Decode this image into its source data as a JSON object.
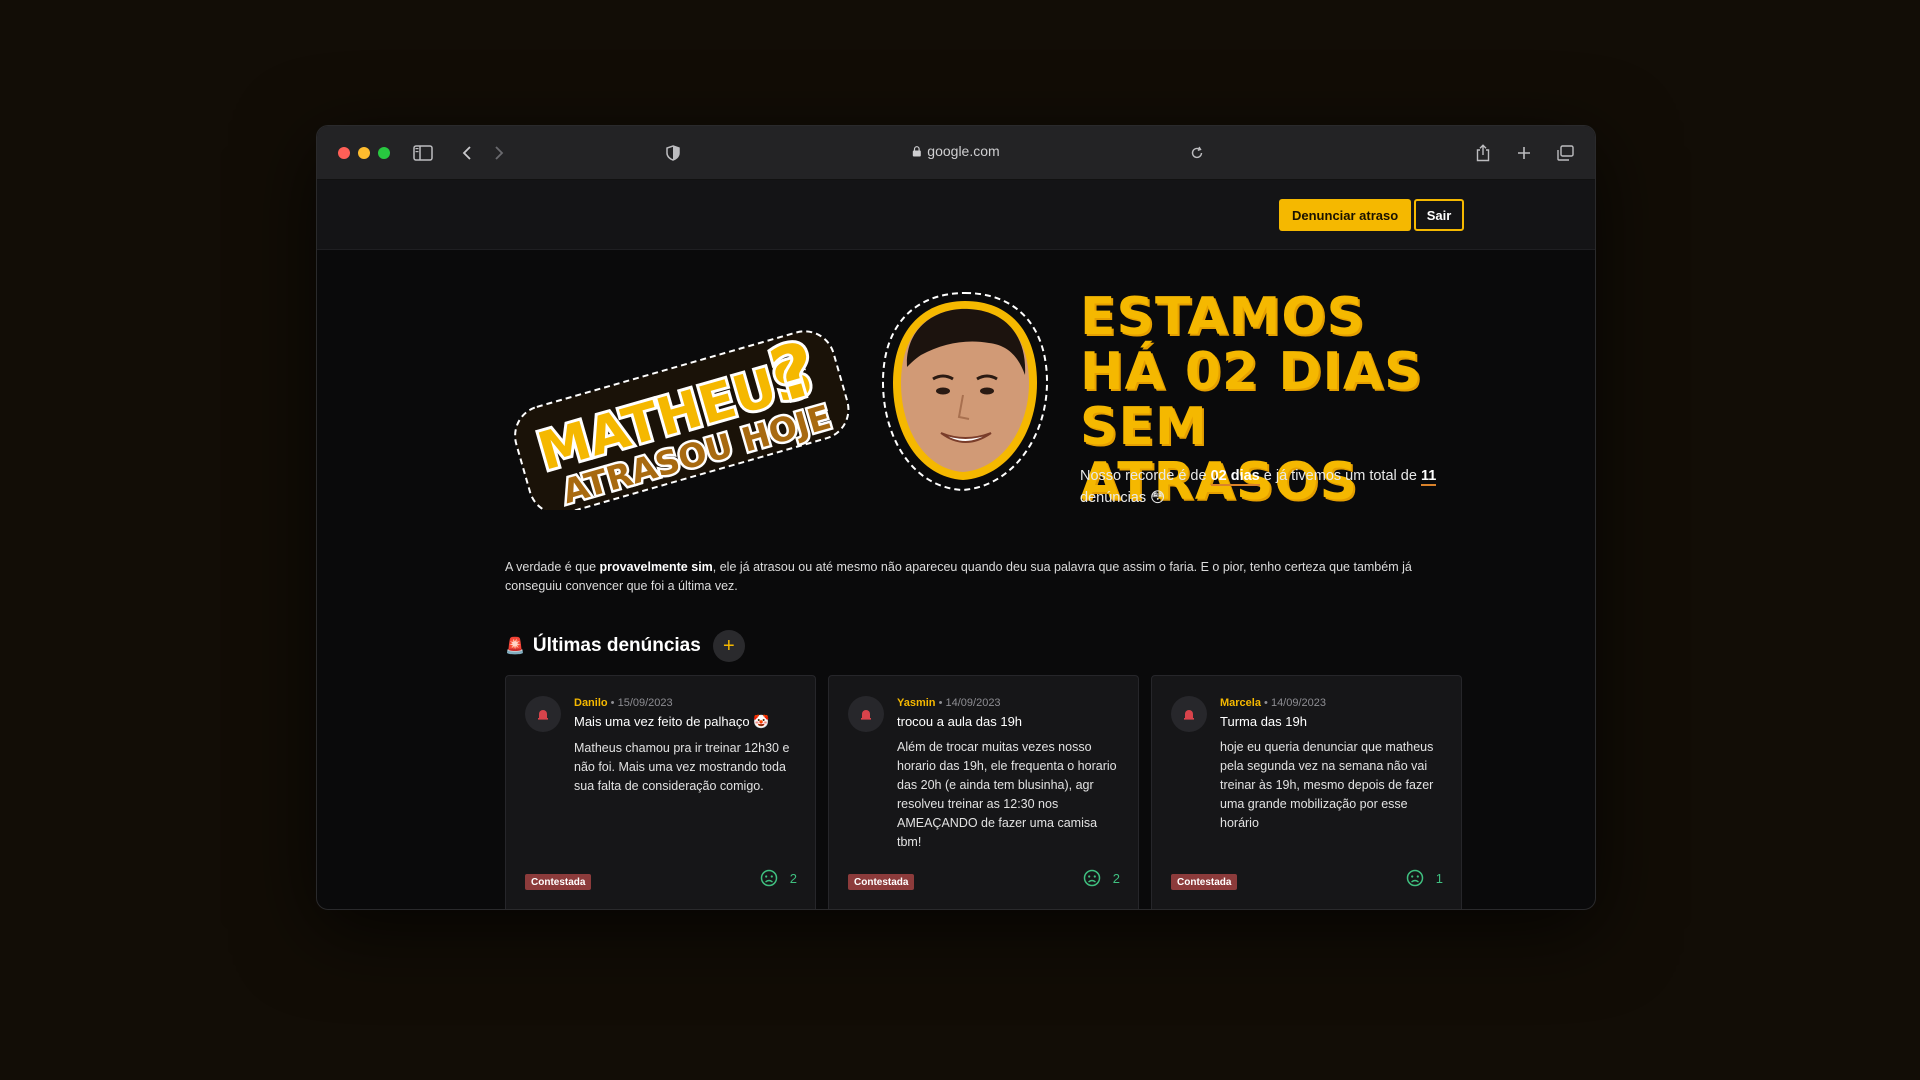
{
  "browser": {
    "url": "google.com"
  },
  "header": {
    "report_button": "Denunciar atraso",
    "logout_button": "Sair"
  },
  "hero": {
    "logo_line1": "MATHEUS",
    "logo_qmark": "?",
    "logo_line2": "ATRASOU HOJE",
    "headline": "ESTAMOS HÁ 02 DIAS SEM ATRASOS",
    "sub_part1": "Nosso recorde é de ",
    "sub_record": "02 dias",
    "sub_part2": " e já tivemos um total de ",
    "sub_total": "11",
    "sub_part3": " denúncias ",
    "sub_emoji": "😳"
  },
  "intro": {
    "part1": "A verdade é que ",
    "bold": "provavelmente sim",
    "part2": ", ele já atrasou ou até mesmo não apareceu quando deu sua palavra que assim o faria. E o pior, tenho certeza que também já conseguiu convencer que foi a última vez."
  },
  "section": {
    "emoji": "🚨",
    "title": "Últimas denúncias",
    "add_label": "+"
  },
  "reports": [
    {
      "author": "Danilo",
      "date": " • 15/09/2023",
      "title": "Mais uma vez feito de palhaço 🤡",
      "text": "Matheus chamou pra ir treinar 12h30 e não foi. Mais uma vez mostrando toda sua falta de consideração comigo.",
      "status": "Contestada",
      "votes": "2"
    },
    {
      "author": "Yasmin",
      "date": " • 14/09/2023",
      "title": "trocou a aula das 19h",
      "text": "Além de trocar muitas vezes nosso horario das 19h, ele frequenta o horario das 20h (e ainda tem blusinha), agr resolveu treinar as 12:30 nos AMEAÇANDO de fazer uma camisa tbm!",
      "status": "Contestada",
      "votes": "2"
    },
    {
      "author": "Marcela",
      "date": " • 14/09/2023",
      "title": "Turma das 19h",
      "text": "hoje eu queria denunciar que matheus pela segunda vez na semana não vai treinar às 19h, mesmo depois de fazer uma grande mobilização por esse horário",
      "status": "Contestada",
      "votes": "1"
    }
  ],
  "colors": {
    "accent": "#f5b800",
    "badge": "#8c3b3b",
    "vote": "#3fbf7f"
  }
}
